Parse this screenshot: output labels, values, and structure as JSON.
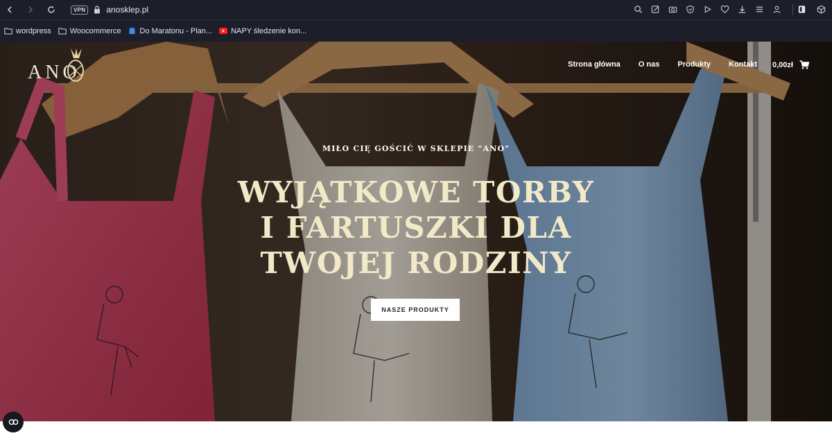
{
  "browser": {
    "url": "anosklep.pl",
    "vpn_label": "VPN",
    "icons": [
      "back-icon",
      "forward-icon",
      "reload-icon",
      "lock-icon",
      "search-icon",
      "edit-icon",
      "camera-icon",
      "shield-icon",
      "play-icon",
      "heart-icon",
      "download-icon",
      "menu-icon",
      "profile-icon",
      "extension-icon",
      "cube-icon"
    ]
  },
  "bookmarks": [
    {
      "label": "wordpress",
      "icon": "folder-icon"
    },
    {
      "label": "Woocommerce",
      "icon": "folder-icon"
    },
    {
      "label": "Do Maratonu - Plan...",
      "icon": "sheet-icon"
    },
    {
      "label": "NAPY śledzenie kon...",
      "icon": "youtube-icon"
    }
  ],
  "site": {
    "logo_text": "ANO",
    "nav": [
      "Strona główna",
      "O nas",
      "Produkty",
      "Kontakt"
    ],
    "cart_total": "0,00zł",
    "subtitle": "MIŁO CIĘ GOŚCIĆ W SKLEPIE \"ANO\"",
    "headline": [
      "WYJĄTKOWE TORBY",
      "I FARTUSZKI DLA",
      "TWOJEJ RODZINY"
    ],
    "cta_label": "NASZE PRODUKTY"
  },
  "colors": {
    "browser_bg": "#1c1f2a",
    "headline": "#f2e9c9",
    "apron_pink": "#d94a6d",
    "apron_beige": "#e8e1d6",
    "apron_blue": "#8fb3d6"
  }
}
